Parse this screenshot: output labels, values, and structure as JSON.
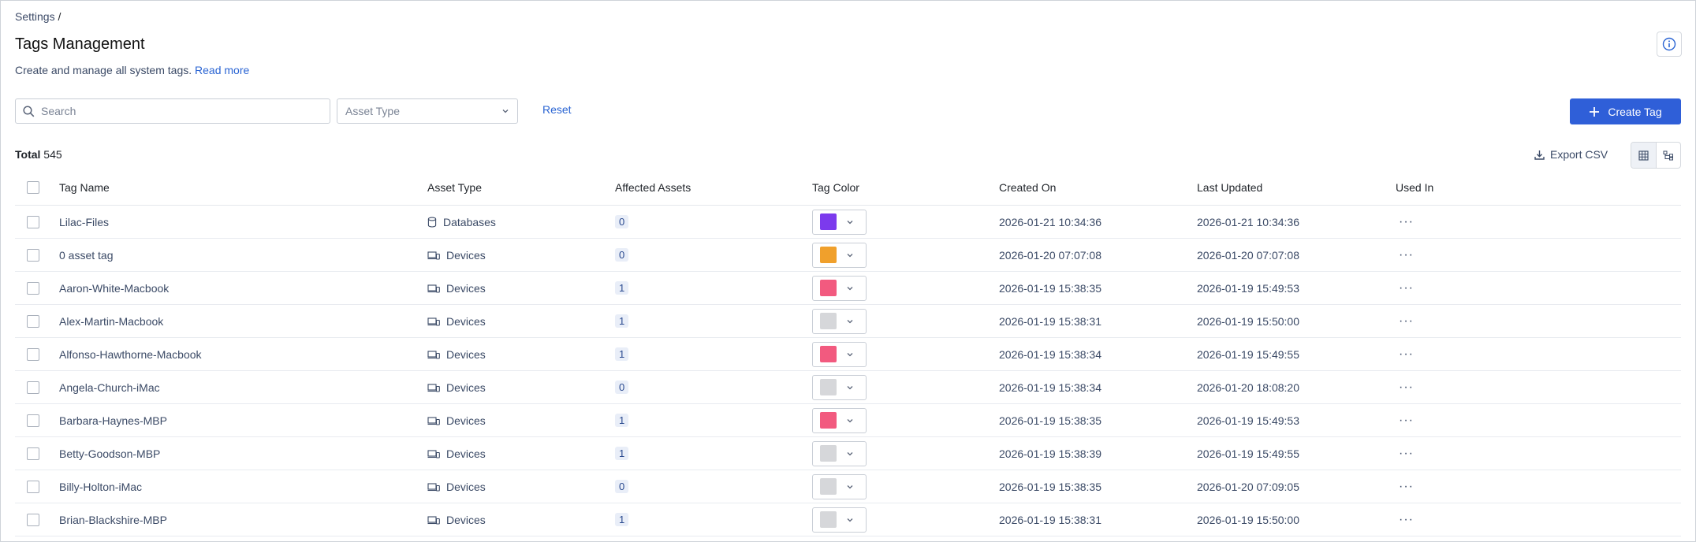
{
  "breadcrumb": {
    "parent": "Settings",
    "separator": "/"
  },
  "page": {
    "title": "Tags Management",
    "subtitle": "Create and manage all system tags.",
    "read_more": "Read more"
  },
  "filters": {
    "search_placeholder": "Search",
    "asset_type_placeholder": "Asset Type",
    "reset_label": "Reset"
  },
  "toolbar": {
    "create_label": "Create Tag",
    "total_label": "Total",
    "total_count": "545",
    "export_label": "Export CSV"
  },
  "colors": {
    "primary": "#2f5fd8",
    "link": "#2a64d3",
    "purple": "#7c3aed",
    "orange": "#f0a02c",
    "pink": "#f25a7f",
    "gray": "#d6d7da"
  },
  "table": {
    "headers": {
      "name": "Tag Name",
      "asset_type": "Asset Type",
      "affected": "Affected Assets",
      "color": "Tag Color",
      "created": "Created On",
      "updated": "Last Updated",
      "used_in": "Used In"
    },
    "rows": [
      {
        "name": "Lilac-Files",
        "asset_type": "Databases",
        "icon": "database-icon",
        "affected": "0",
        "color": "#7c3aed",
        "created": "2026-01-21 10:34:36",
        "updated": "2026-01-21 10:34:36",
        "used_in": "···"
      },
      {
        "name": "0 asset tag",
        "asset_type": "Devices",
        "icon": "devices-icon",
        "affected": "0",
        "color": "#f0a02c",
        "created": "2026-01-20 07:07:08",
        "updated": "2026-01-20 07:07:08",
        "used_in": "···"
      },
      {
        "name": "Aaron-White-Macbook",
        "asset_type": "Devices",
        "icon": "devices-icon",
        "affected": "1",
        "color": "#f25a7f",
        "created": "2026-01-19 15:38:35",
        "updated": "2026-01-19 15:49:53",
        "used_in": "···"
      },
      {
        "name": "Alex-Martin-Macbook",
        "asset_type": "Devices",
        "icon": "devices-icon",
        "affected": "1",
        "color": "#d6d7da",
        "created": "2026-01-19 15:38:31",
        "updated": "2026-01-19 15:50:00",
        "used_in": "···"
      },
      {
        "name": "Alfonso-Hawthorne-Macbook",
        "asset_type": "Devices",
        "icon": "devices-icon",
        "affected": "1",
        "color": "#f25a7f",
        "created": "2026-01-19 15:38:34",
        "updated": "2026-01-19 15:49:55",
        "used_in": "···"
      },
      {
        "name": "Angela-Church-iMac",
        "asset_type": "Devices",
        "icon": "devices-icon",
        "affected": "0",
        "color": "#d6d7da",
        "created": "2026-01-19 15:38:34",
        "updated": "2026-01-20 18:08:20",
        "used_in": "···"
      },
      {
        "name": "Barbara-Haynes-MBP",
        "asset_type": "Devices",
        "icon": "devices-icon",
        "affected": "1",
        "color": "#f25a7f",
        "created": "2026-01-19 15:38:35",
        "updated": "2026-01-19 15:49:53",
        "used_in": "···"
      },
      {
        "name": "Betty-Goodson-MBP",
        "asset_type": "Devices",
        "icon": "devices-icon",
        "affected": "1",
        "color": "#d6d7da",
        "created": "2026-01-19 15:38:39",
        "updated": "2026-01-19 15:49:55",
        "used_in": "···"
      },
      {
        "name": "Billy-Holton-iMac",
        "asset_type": "Devices",
        "icon": "devices-icon",
        "affected": "0",
        "color": "#d6d7da",
        "created": "2026-01-19 15:38:35",
        "updated": "2026-01-20 07:09:05",
        "used_in": "···"
      },
      {
        "name": "Brian-Blackshire-MBP",
        "asset_type": "Devices",
        "icon": "devices-icon",
        "affected": "1",
        "color": "#d6d7da",
        "created": "2026-01-19 15:38:31",
        "updated": "2026-01-19 15:50:00",
        "used_in": "···"
      }
    ]
  }
}
